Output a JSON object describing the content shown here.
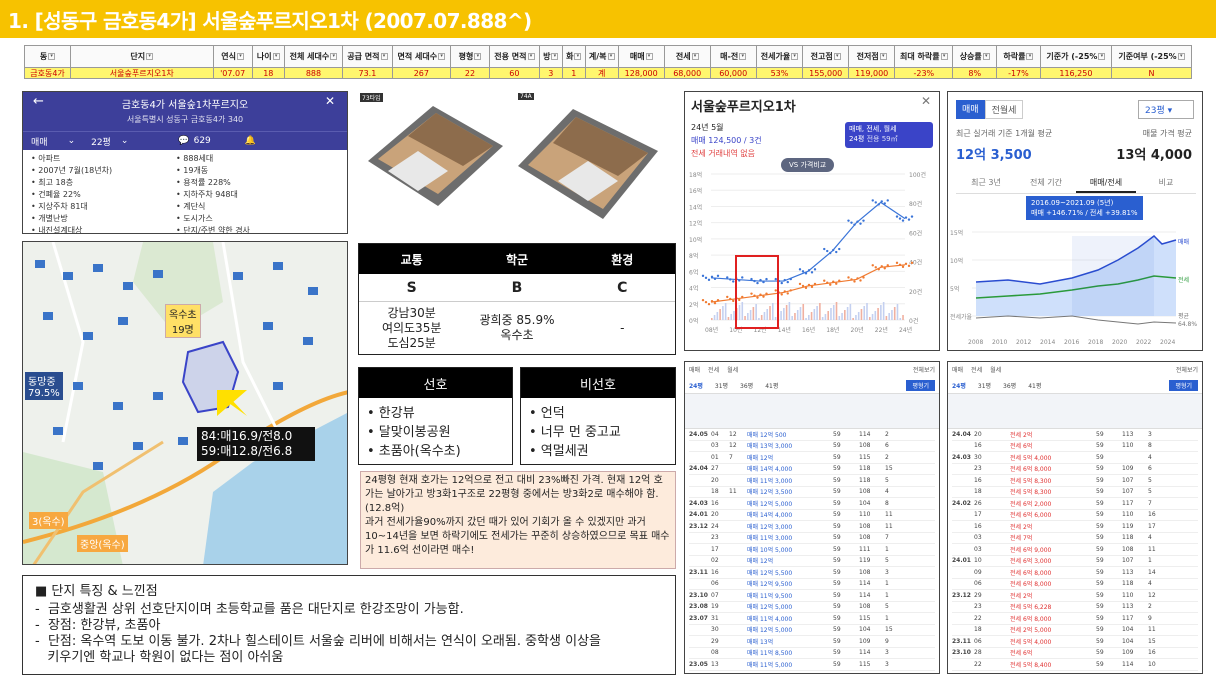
{
  "title": "1. [성동구 금호동4가] 서울숲푸르지오1차 (2007.07.888^)",
  "table": {
    "headers": [
      "동",
      "단지",
      "연식",
      "나이",
      "전체 세대수",
      "공급 면적",
      "면적 세대수",
      "평형",
      "전용 면적",
      "방",
      "화",
      "계/복",
      "매매",
      "전세",
      "매-전",
      "전세가율",
      "전고점",
      "전저점",
      "최대 하락률",
      "상승률",
      "하락률",
      "기준가 (-25%",
      "기준여부 (-25%"
    ],
    "row": [
      "금호동4가",
      "서울숲푸르지오1차",
      "'07.07",
      "18",
      "888",
      "73.1",
      "267",
      "22",
      "60",
      "3",
      "1",
      "계",
      "128,000",
      "68,000",
      "60,000",
      "53%",
      "155,000",
      "119,000",
      "-23%",
      "8%",
      "-17%",
      "116,250",
      "N"
    ]
  },
  "app": {
    "title": "금호동4가 서울숲1차푸르지오",
    "address": "서울특별시 성동구 금호동4가 340",
    "filter_type": "매매",
    "filter_size": "22평",
    "comment_count": "629",
    "info_left": [
      "아파트",
      "2007년 7월(18년차)",
      "최고 18층",
      "건폐율 22%",
      "지상주차 81대",
      "개별난방",
      "내진설계대상"
    ],
    "info_right": [
      "888세대",
      "19개동",
      "용적률 228%",
      "지하주차 948대",
      "계단식",
      "도시가스",
      "단지/주변 약한 경사"
    ]
  },
  "map": {
    "school_label": "옥수초\n19명",
    "middle_label": "동망중\n79.5%",
    "station1": "3(옥수)",
    "station2": "중앙(옥수)",
    "price1": "84:매16.9/전8.0",
    "price2": "59:매12.8/전6.8"
  },
  "floorplans": {
    "left_tag": "73타입",
    "right_tag": "74A"
  },
  "grade": {
    "headers": [
      "교통",
      "학군",
      "환경"
    ],
    "grades": [
      "S",
      "B",
      "C"
    ],
    "traffic": "강남30분\n여의도35분\n도심25분",
    "school": "광희중 85.9%\n옥수초",
    "env": "-"
  },
  "pref": {
    "pos_title": "선호",
    "neg_title": "비선호",
    "pos": [
      "한강뷰",
      "달맞이봉공원",
      "초품아(옥수초)"
    ],
    "neg": [
      "언덕",
      "너무 먼 중고교",
      "역멀세권"
    ]
  },
  "analysis": "24평형 현재 호가는 12억으로 전고 대비 23%빠진 가격. 현재 12억 호가는 날아가고 방3화1구조로 22평형 중에서는 방3화2로 매수해야 함.(12.8억)\n과거 전세가율90%까지 갔던 때가 있어 기회가 올 수 있겠지만 과거10~14년을 보면 하락기에도 전세가는 꾸준히 상승하였으므로 목표 매수가 11.6억 선이라면 매수!",
  "features": {
    "title": "■ 단지 특징 & 느낀점",
    "items": [
      "-  금호생활권 상위 선호단지이며 초등학교를 품은 대단지로 한강조망이 가능함.",
      "-  장점: 한강뷰, 초품아",
      "-  단점: 옥수역 도보 이동 불가. 2차나 힐스테이트 서울숲 리버에 비해서는 연식이 오래됨. 중학생 이상을\n   키우기엔 학교나 학원이 없다는 점이 아쉬움"
    ]
  },
  "price_chart": {
    "title": "서울숲푸르지오1차",
    "period": "24년 5월",
    "trade_text": "매매 124,500 / 3건",
    "rent_text": "전세 거래내역 없음",
    "vs_button": "VS 가격비교",
    "filter_label": "매매, 전세, 월세",
    "size_label": "24평",
    "size_sub": "전용 59㎡",
    "y_left": [
      "18억",
      "16억",
      "14억",
      "12억",
      "10억",
      "8억",
      "6억",
      "4억",
      "2억",
      "0억"
    ],
    "y_right": [
      "100건",
      "80건",
      "60건",
      "40건",
      "20건",
      "0건"
    ],
    "x_labels": [
      "08년",
      "10년",
      "12년",
      "14년",
      "16년",
      "18년",
      "20년",
      "22년",
      "24년"
    ]
  },
  "chart_data": {
    "type": "line",
    "title": "서울숲푸르지오1차",
    "x": [
      "08년",
      "10년",
      "12년",
      "14년",
      "16년",
      "18년",
      "20년",
      "22년",
      "24년"
    ],
    "series": [
      {
        "name": "매매",
        "values": [
          5.2,
          5.0,
          4.8,
          4.8,
          6.0,
          8.5,
          12.0,
          14.5,
          12.5
        ]
      },
      {
        "name": "전세",
        "values": [
          2.2,
          2.6,
          3.0,
          3.4,
          4.2,
          4.6,
          5.0,
          6.5,
          6.8
        ]
      }
    ],
    "ylim": [
      0,
      18
    ]
  },
  "stat_app": {
    "tabs": [
      "매매",
      "전월세"
    ],
    "size_select": "23평",
    "avg_label": "최근 실거래 기준 1개월 평균",
    "avg_price": "12억 3,500",
    "ask_label": "매물 가격 평균",
    "ask_price": "13억 4,000",
    "period_tabs": [
      "최근 3년",
      "전체 기간",
      "매매/전세",
      "비교"
    ],
    "tooltip_period": "2016.09~2021.09 (5년)",
    "tooltip_value": "매매 +146.71% / 전세 +39.81%",
    "y_labels": [
      "15억",
      "10억",
      "5억",
      "전세가율"
    ],
    "legend": [
      "매매",
      "전세",
      "평균",
      "64.8%"
    ],
    "x_labels": [
      "2008",
      "2010",
      "2012",
      "2014",
      "2016",
      "2018",
      "2020",
      "2022",
      "2024"
    ]
  },
  "trade_left": {
    "tabs": [
      "매매",
      "전세",
      "월세"
    ],
    "sort": "전체보기",
    "sizes": [
      "24평",
      "31평",
      "36평",
      "41평"
    ],
    "btn": "평형기",
    "rows": [
      [
        "24.05",
        "04",
        "12",
        "매매 12억 500",
        "59",
        "114",
        "2"
      ],
      [
        "",
        "03",
        "12",
        "매매 13억 3,000",
        "59",
        "108",
        "6"
      ],
      [
        "",
        "01",
        "7",
        "매매 12억",
        "59",
        "115",
        "2"
      ],
      [
        "24.04",
        "27",
        "",
        "매매 14억 4,000",
        "59",
        "118",
        "15"
      ],
      [
        "",
        "20",
        "",
        "매매 11억 3,000",
        "59",
        "118",
        "5"
      ],
      [
        "",
        "18",
        "11",
        "매매 12억 3,500",
        "59",
        "108",
        "4"
      ],
      [
        "24.03",
        "16",
        "",
        "매매 12억 5,000",
        "59",
        "104",
        "8"
      ],
      [
        "24.01",
        "20",
        "",
        "매매 14억 4,000",
        "59",
        "110",
        "11"
      ],
      [
        "23.12",
        "24",
        "",
        "매매 12억 3,000",
        "59",
        "108",
        "11"
      ],
      [
        "",
        "23",
        "",
        "매매 11억 3,000",
        "59",
        "108",
        "7"
      ],
      [
        "",
        "17",
        "",
        "매매 10억 5,000",
        "59",
        "111",
        "1"
      ],
      [
        "",
        "02",
        "",
        "매매 12억",
        "59",
        "119",
        "5"
      ],
      [
        "23.11",
        "16",
        "",
        "매매 12억 5,500",
        "59",
        "108",
        "3"
      ],
      [
        "",
        "06",
        "",
        "매매 12억 9,500",
        "59",
        "114",
        "1"
      ],
      [
        "23.10",
        "07",
        "",
        "매매 11억 9,500",
        "59",
        "114",
        "1"
      ],
      [
        "23.08",
        "19",
        "",
        "매매 12억 5,000",
        "59",
        "108",
        "5"
      ],
      [
        "23.07",
        "31",
        "",
        "매매 11억 4,000",
        "59",
        "115",
        "1"
      ],
      [
        "",
        "30",
        "",
        "매매 12억 5,000",
        "59",
        "104",
        "15"
      ],
      [
        "",
        "29",
        "",
        "매매 13억",
        "59",
        "109",
        "9"
      ],
      [
        "",
        "08",
        "",
        "매매 11억 8,500",
        "59",
        "114",
        "3"
      ],
      [
        "23.05",
        "13",
        "",
        "매매 11억 5,000",
        "59",
        "115",
        "3"
      ]
    ]
  },
  "trade_right": {
    "tabs": [
      "매매",
      "전세",
      "월세"
    ],
    "sort": "전체보기",
    "sizes": [
      "24평",
      "31평",
      "36평",
      "41평"
    ],
    "btn": "평형기",
    "rows": [
      [
        "24.04",
        "20",
        "",
        "전세 2억",
        "59",
        "113",
        "3"
      ],
      [
        "",
        "16",
        "",
        "전세 6억",
        "59",
        "110",
        "8"
      ],
      [
        "24.03",
        "30",
        "",
        "전세 5억 4,000",
        "59",
        "",
        "4"
      ],
      [
        "",
        "23",
        "",
        "전세 6억 8,000",
        "59",
        "109",
        "6"
      ],
      [
        "",
        "16",
        "",
        "전세 5억 8,300",
        "59",
        "107",
        "5"
      ],
      [
        "",
        "18",
        "",
        "전세 5억 8,300",
        "59",
        "107",
        "5"
      ],
      [
        "24.02",
        "26",
        "",
        "전세 6억 2,000",
        "59",
        "117",
        "7"
      ],
      [
        "",
        "17",
        "",
        "전세 6억 6,000",
        "59",
        "110",
        "16"
      ],
      [
        "",
        "16",
        "",
        "전세 2억",
        "59",
        "119",
        "17"
      ],
      [
        "",
        "03",
        "",
        "전세 7억",
        "59",
        "118",
        "4"
      ],
      [
        "",
        "03",
        "",
        "전세 6억 9,000",
        "59",
        "108",
        "11"
      ],
      [
        "24.01",
        "10",
        "",
        "전세 6억 3,000",
        "59",
        "107",
        "1"
      ],
      [
        "",
        "09",
        "",
        "전세 6억 8,000",
        "59",
        "113",
        "14"
      ],
      [
        "",
        "06",
        "",
        "전세 6억 8,000",
        "59",
        "118",
        "4"
      ],
      [
        "23.12",
        "29",
        "",
        "전세 2억",
        "59",
        "110",
        "12"
      ],
      [
        "",
        "23",
        "",
        "전세 5억 6,228",
        "59",
        "113",
        "2"
      ],
      [
        "",
        "22",
        "",
        "전세 6억 8,000",
        "59",
        "117",
        "9"
      ],
      [
        "",
        "18",
        "",
        "전세 2억 5,000",
        "59",
        "104",
        "11"
      ],
      [
        "23.11",
        "06",
        "",
        "전세 5억 4,000",
        "59",
        "104",
        "15"
      ],
      [
        "23.10",
        "28",
        "",
        "전세 6억",
        "59",
        "109",
        "16"
      ],
      [
        "",
        "22",
        "",
        "전세 5억 8,400",
        "59",
        "114",
        "10"
      ]
    ]
  }
}
